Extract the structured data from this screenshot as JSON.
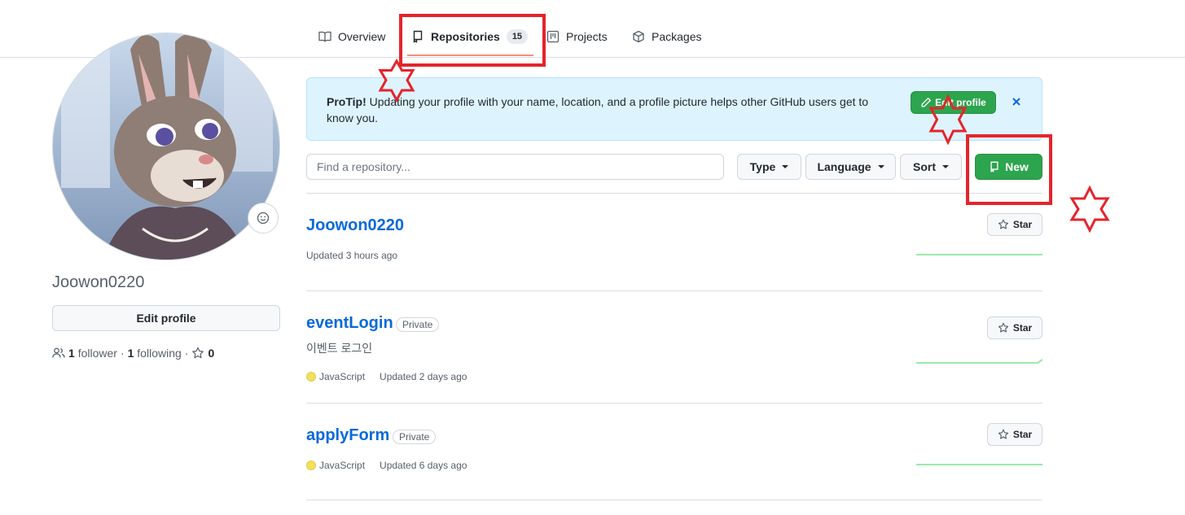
{
  "tabs": [
    {
      "label": "Overview"
    },
    {
      "label": "Repositories",
      "count": "15"
    },
    {
      "label": "Projects"
    },
    {
      "label": "Packages"
    }
  ],
  "profile": {
    "username": "Joowon0220",
    "edit_label": "Edit profile",
    "followers_count": "1",
    "followers_label": "follower",
    "following_count": "1",
    "following_label": "following",
    "stars_count": "0",
    "sep": "·"
  },
  "protip": {
    "lead": "ProTip!",
    "text": " Updating your profile with your name, location, and a profile picture helps other GitHub users get to know you.",
    "button_label": "Edit profile"
  },
  "filters": {
    "search_placeholder": "Find a repository...",
    "type_label": "Type",
    "language_label": "Language",
    "sort_label": "Sort",
    "new_label": "New"
  },
  "repos": [
    {
      "name": "Joowon0220",
      "updated": "Updated 3 hours ago",
      "star_label": "Star"
    },
    {
      "name": "eventLogin",
      "visibility": "Private",
      "description": "이벤트 로그인",
      "language": "JavaScript",
      "updated": "Updated 2 days ago",
      "star_label": "Star"
    },
    {
      "name": "applyForm",
      "visibility": "Private",
      "language": "JavaScript",
      "updated": "Updated 6 days ago",
      "star_label": "Star"
    }
  ],
  "colors": {
    "accent_link": "#0969da",
    "primary_button": "#2da44e",
    "javascript": "#f1e05a",
    "annotation": "#e5242b"
  },
  "icons": [
    "book-icon",
    "repo-icon",
    "project-icon",
    "package-icon",
    "smiley-icon",
    "people-icon",
    "star-icon",
    "pencil-icon",
    "close-icon",
    "caret-down-icon"
  ]
}
